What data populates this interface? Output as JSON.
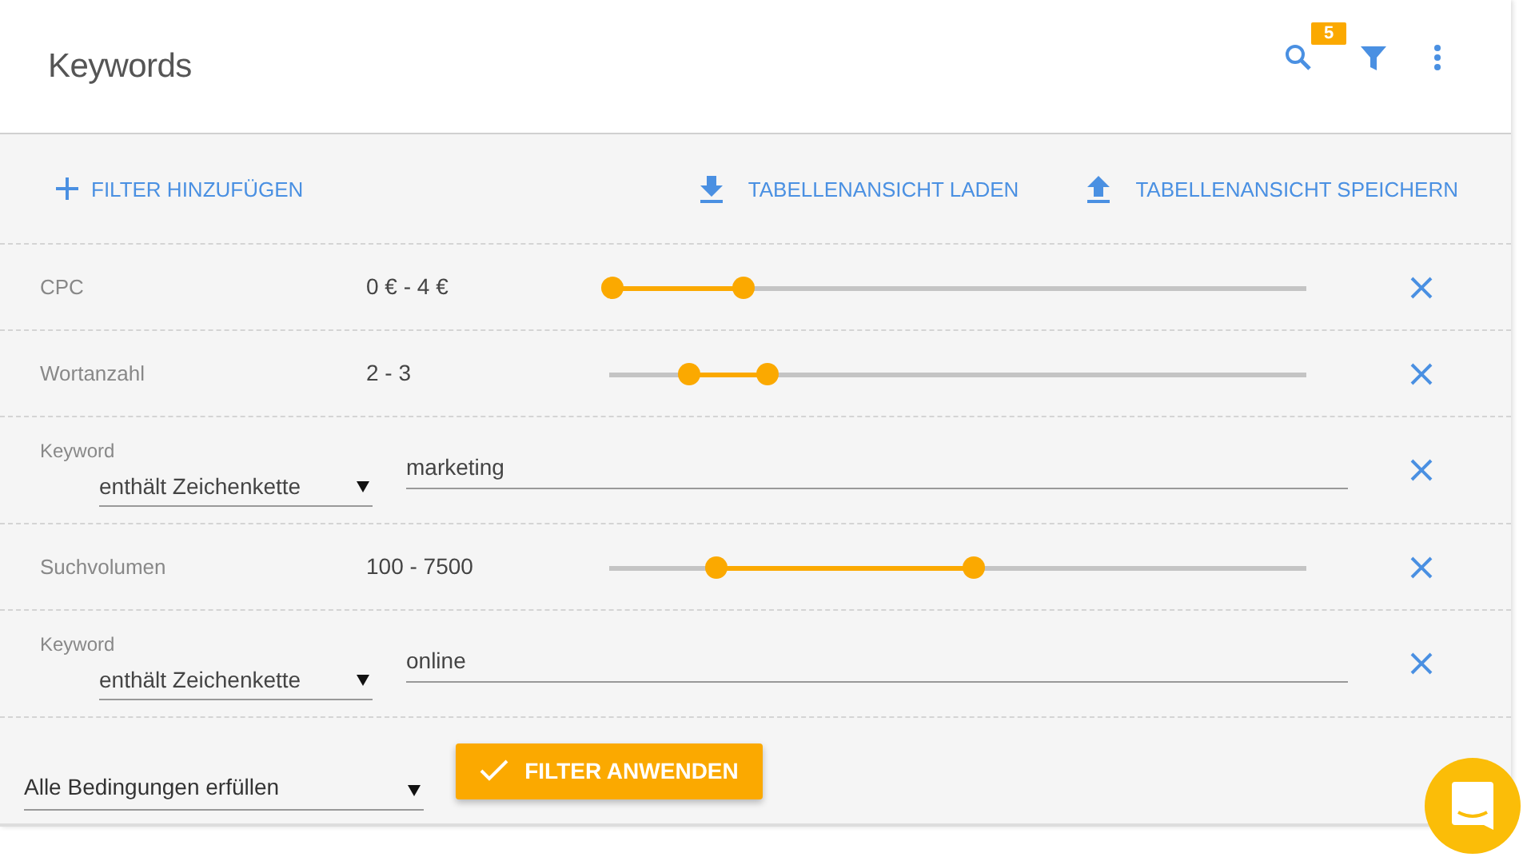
{
  "header": {
    "title": "Keywords",
    "filter_badge": "5"
  },
  "toolbar": {
    "add_filter": "FILTER HINZUFÜGEN",
    "load_view": "TABELLENANSICHT LADEN",
    "save_view": "TABELLENANSICHT SPEICHERN"
  },
  "filters": [
    {
      "kind": "range",
      "label": "CPC",
      "reading": "0 € - 4 €",
      "thumbs": [
        {
          "level": 0.005
        },
        {
          "level": 0.193
        }
      ]
    },
    {
      "kind": "range",
      "label": "Wortanzahl",
      "reading": "2 - 3",
      "thumbs": [
        {
          "level": 0.115
        },
        {
          "level": 0.227
        }
      ]
    },
    {
      "kind": "text",
      "label": "Keyword",
      "operator": "enthält Zeichenkette",
      "value": "marketing"
    },
    {
      "kind": "range",
      "label": "Suchvolumen",
      "reading": "100 - 7500",
      "thumbs": [
        {
          "level": 0.154
        },
        {
          "level": 0.523
        }
      ]
    },
    {
      "kind": "text",
      "label": "Keyword",
      "operator": "enthält Zeichenkette",
      "value": "online"
    }
  ],
  "footer": {
    "match_mode": "Alle Bedingungen erfüllen",
    "apply": "FILTER ANWENDEN"
  }
}
